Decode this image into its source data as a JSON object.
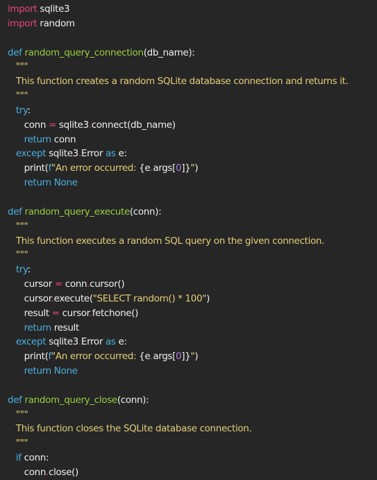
{
  "colors": {
    "background": "#262626",
    "plain": "#f0f0f0",
    "keyword_import": "#e8457a",
    "keyword_control": "#4ab0de",
    "function_name": "#9acd3f",
    "string_docstring": "#e2cf78",
    "operator": "#e8457a",
    "number": "#b07fe0"
  },
  "code": {
    "lines": [
      [
        {
          "t": "kw",
          "v": "import"
        },
        {
          "t": "plain",
          "v": " sqlite3"
        }
      ],
      [
        {
          "t": "kw",
          "v": "import"
        },
        {
          "t": "plain",
          "v": " random"
        }
      ],
      [],
      [
        {
          "t": "def",
          "v": "def"
        },
        {
          "t": "plain",
          "v": " "
        },
        {
          "t": "fn",
          "v": "random_query_connection"
        },
        {
          "t": "plain",
          "v": "(db_name):"
        }
      ],
      [
        {
          "t": "plain",
          "v": "   "
        },
        {
          "t": "doc",
          "v": "\"\"\""
        }
      ],
      [
        {
          "t": "plain",
          "v": "   "
        },
        {
          "t": "doc",
          "v": "This function creates a random SQLite database connection and returns it."
        }
      ],
      [
        {
          "t": "plain",
          "v": "   "
        },
        {
          "t": "doc",
          "v": "\"\"\""
        }
      ],
      [
        {
          "t": "plain",
          "v": "   "
        },
        {
          "t": "ctrl",
          "v": "try"
        },
        {
          "t": "plain",
          "v": ":"
        }
      ],
      [
        {
          "t": "plain",
          "v": "      conn "
        },
        {
          "t": "op",
          "v": "="
        },
        {
          "t": "plain",
          "v": " sqlite3"
        },
        {
          "t": "op",
          "v": "."
        },
        {
          "t": "plain",
          "v": "connect(db_name)"
        }
      ],
      [
        {
          "t": "plain",
          "v": "      "
        },
        {
          "t": "ctrl",
          "v": "return"
        },
        {
          "t": "plain",
          "v": " conn"
        }
      ],
      [
        {
          "t": "plain",
          "v": "   "
        },
        {
          "t": "ctrl",
          "v": "except"
        },
        {
          "t": "plain",
          "v": " sqlite3"
        },
        {
          "t": "op",
          "v": "."
        },
        {
          "t": "plain",
          "v": "Error "
        },
        {
          "t": "ctrl",
          "v": "as"
        },
        {
          "t": "plain",
          "v": " e:"
        }
      ],
      [
        {
          "t": "plain",
          "v": "      print("
        },
        {
          "t": "ctrl",
          "v": "f"
        },
        {
          "t": "str",
          "v": "\"An error occurred: "
        },
        {
          "t": "plain",
          "v": "{e"
        },
        {
          "t": "op",
          "v": "."
        },
        {
          "t": "plain",
          "v": "args["
        },
        {
          "t": "num",
          "v": "0"
        },
        {
          "t": "plain",
          "v": "]}"
        },
        {
          "t": "str",
          "v": "\""
        },
        {
          "t": "plain",
          "v": ")"
        }
      ],
      [
        {
          "t": "plain",
          "v": "      "
        },
        {
          "t": "ctrl",
          "v": "return"
        },
        {
          "t": "plain",
          "v": " "
        },
        {
          "t": "const",
          "v": "None"
        }
      ],
      [],
      [
        {
          "t": "def",
          "v": "def"
        },
        {
          "t": "plain",
          "v": " "
        },
        {
          "t": "fn",
          "v": "random_query_execute"
        },
        {
          "t": "plain",
          "v": "(conn):"
        }
      ],
      [
        {
          "t": "plain",
          "v": "   "
        },
        {
          "t": "doc",
          "v": "\"\"\""
        }
      ],
      [
        {
          "t": "plain",
          "v": "   "
        },
        {
          "t": "doc",
          "v": "This function executes a random SQL query on the given connection."
        }
      ],
      [
        {
          "t": "plain",
          "v": "   "
        },
        {
          "t": "doc",
          "v": "\"\"\""
        }
      ],
      [
        {
          "t": "plain",
          "v": "   "
        },
        {
          "t": "ctrl",
          "v": "try"
        },
        {
          "t": "plain",
          "v": ":"
        }
      ],
      [
        {
          "t": "plain",
          "v": "      cursor "
        },
        {
          "t": "op",
          "v": "="
        },
        {
          "t": "plain",
          "v": " conn"
        },
        {
          "t": "op",
          "v": "."
        },
        {
          "t": "plain",
          "v": "cursor()"
        }
      ],
      [
        {
          "t": "plain",
          "v": "      cursor"
        },
        {
          "t": "op",
          "v": "."
        },
        {
          "t": "plain",
          "v": "execute("
        },
        {
          "t": "str",
          "v": "\"SELECT random() * 100\""
        },
        {
          "t": "plain",
          "v": ")"
        }
      ],
      [
        {
          "t": "plain",
          "v": "      result "
        },
        {
          "t": "op",
          "v": "="
        },
        {
          "t": "plain",
          "v": " cursor"
        },
        {
          "t": "op",
          "v": "."
        },
        {
          "t": "plain",
          "v": "fetchone()"
        }
      ],
      [
        {
          "t": "plain",
          "v": "      "
        },
        {
          "t": "ctrl",
          "v": "return"
        },
        {
          "t": "plain",
          "v": " result"
        }
      ],
      [
        {
          "t": "plain",
          "v": "   "
        },
        {
          "t": "ctrl",
          "v": "except"
        },
        {
          "t": "plain",
          "v": " sqlite3"
        },
        {
          "t": "op",
          "v": "."
        },
        {
          "t": "plain",
          "v": "Error "
        },
        {
          "t": "ctrl",
          "v": "as"
        },
        {
          "t": "plain",
          "v": " e:"
        }
      ],
      [
        {
          "t": "plain",
          "v": "      print("
        },
        {
          "t": "ctrl",
          "v": "f"
        },
        {
          "t": "str",
          "v": "\"An error occurred: "
        },
        {
          "t": "plain",
          "v": "{e"
        },
        {
          "t": "op",
          "v": "."
        },
        {
          "t": "plain",
          "v": "args["
        },
        {
          "t": "num",
          "v": "0"
        },
        {
          "t": "plain",
          "v": "]}"
        },
        {
          "t": "str",
          "v": "\""
        },
        {
          "t": "plain",
          "v": ")"
        }
      ],
      [
        {
          "t": "plain",
          "v": "      "
        },
        {
          "t": "ctrl",
          "v": "return"
        },
        {
          "t": "plain",
          "v": " "
        },
        {
          "t": "const",
          "v": "None"
        }
      ],
      [],
      [
        {
          "t": "def",
          "v": "def"
        },
        {
          "t": "plain",
          "v": " "
        },
        {
          "t": "fn",
          "v": "random_query_close"
        },
        {
          "t": "plain",
          "v": "(conn):"
        }
      ],
      [
        {
          "t": "plain",
          "v": "   "
        },
        {
          "t": "doc",
          "v": "\"\"\""
        }
      ],
      [
        {
          "t": "plain",
          "v": "   "
        },
        {
          "t": "doc",
          "v": "This function closes the SQLite database connection."
        }
      ],
      [
        {
          "t": "plain",
          "v": "   "
        },
        {
          "t": "doc",
          "v": "\"\"\""
        }
      ],
      [
        {
          "t": "plain",
          "v": "   "
        },
        {
          "t": "ctrl",
          "v": "if"
        },
        {
          "t": "plain",
          "v": " conn:"
        }
      ],
      [
        {
          "t": "plain",
          "v": "      conn"
        },
        {
          "t": "op",
          "v": "."
        },
        {
          "t": "plain",
          "v": "close()"
        }
      ]
    ]
  }
}
